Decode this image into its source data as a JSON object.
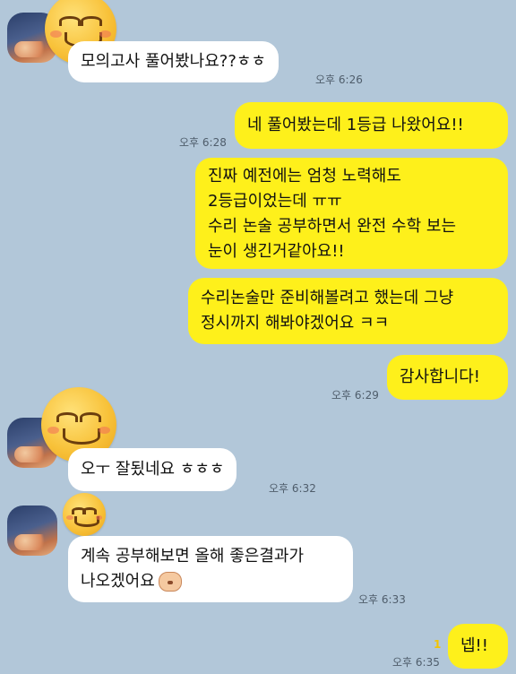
{
  "messages": {
    "m1": {
      "text": "모의고사 풀어봤나요??ㅎㅎ",
      "time": "오후 6:26"
    },
    "m2": {
      "text": "네 풀어봤는데 1등급 나왔어요!!",
      "time": "오후 6:28"
    },
    "m3": {
      "lines": [
        "진짜 예전에는 엄청 노력해도",
        "2등급이었는데 ㅠㅠ",
        "수리 논술 공부하면서 완전 수학 보는",
        "눈이 생긴거같아요!!"
      ]
    },
    "m4": {
      "lines": [
        "수리논술만 준비해볼려고 했는데 그냥",
        "정시까지 해봐야겠어요 ㅋㅋ"
      ]
    },
    "m5": {
      "text": "감사합니다!",
      "time": "오후 6:29"
    },
    "m6": {
      "text": "오ㅜ 잘됬네요 ㅎㅎㅎ",
      "time": "오후 6:32"
    },
    "m7": {
      "lines": [
        "계속 공부해보면 올해 좋은결과가",
        "나오겠어요"
      ],
      "time": "오후 6:33"
    },
    "m8": {
      "text": "넵!!",
      "time": "오후 6:35",
      "unread": "1"
    }
  },
  "icons": {
    "avatar": "profile-photo-sunset-clouds",
    "emoji": "smiling-face-emoji",
    "sticker": "bear-face-sticker"
  },
  "colors": {
    "background": "#b2c7d9",
    "outgoing_bubble": "#fef01b",
    "incoming_bubble": "#ffffff",
    "unread_count": "#f4c400"
  }
}
